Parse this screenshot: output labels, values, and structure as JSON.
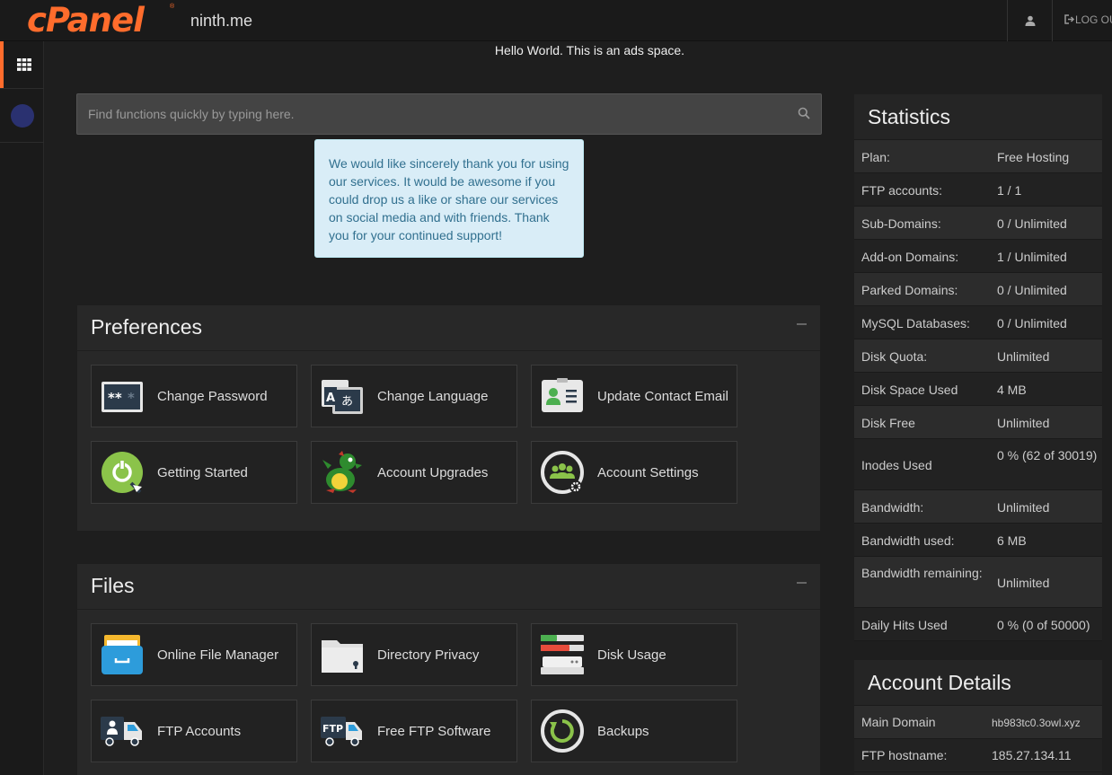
{
  "header": {
    "logo_text": "cPanel",
    "domain": "ninth.me",
    "user_icon": "user-icon",
    "logout_label": "LOG OUT"
  },
  "ads_text": "Hello World. This is an ads space.",
  "search": {
    "placeholder": "Find functions quickly by typing here."
  },
  "notice": "We would like sincerely thank you for using our services. It would be awesome if you could drop us a like or share our services on social media and with friends. Thank you for your continued support!",
  "preferences": {
    "title": "Preferences",
    "items": [
      {
        "label": "Change Password",
        "icon": "password-icon"
      },
      {
        "label": "Change Language",
        "icon": "language-icon"
      },
      {
        "label": "Update Contact Email",
        "icon": "contact-card-icon"
      },
      {
        "label": "Getting Started",
        "icon": "getting-started-icon"
      },
      {
        "label": "Account Upgrades",
        "icon": "dragon-icon"
      },
      {
        "label": "Account Settings",
        "icon": "account-settings-icon"
      }
    ]
  },
  "files": {
    "title": "Files",
    "items": [
      {
        "label": "Online File Manager",
        "icon": "file-manager-icon"
      },
      {
        "label": "Directory Privacy",
        "icon": "folder-lock-icon"
      },
      {
        "label": "Disk Usage",
        "icon": "disk-usage-icon"
      },
      {
        "label": "FTP Accounts",
        "icon": "ftp-accounts-icon"
      },
      {
        "label": "Free FTP Software",
        "icon": "ftp-software-icon"
      },
      {
        "label": "Backups",
        "icon": "backup-icon"
      }
    ]
  },
  "statistics": {
    "title": "Statistics",
    "rows": [
      {
        "label": "Plan:",
        "value": "Free Hosting"
      },
      {
        "label": "FTP accounts:",
        "value": "1 / 1"
      },
      {
        "label": "Sub-Domains:",
        "value": "0 / Unlimited"
      },
      {
        "label": "Add-on Domains:",
        "value": "1 / Unlimited"
      },
      {
        "label": "Parked Domains:",
        "value": "0 / Unlimited"
      },
      {
        "label": "MySQL Databases:",
        "value": "0 / Unlimited"
      },
      {
        "label": "Disk Quota:",
        "value": "Unlimited"
      },
      {
        "label": "Disk Space Used",
        "value": "4 MB"
      },
      {
        "label": "Disk Free",
        "value": "Unlimited"
      },
      {
        "label": "Inodes Used",
        "value": "0 % (62 of 30019)"
      },
      {
        "label": "Bandwidth:",
        "value": "Unlimited"
      },
      {
        "label": "Bandwidth used:",
        "value": "6 MB"
      },
      {
        "label": "Bandwidth remaining:",
        "value": "Unlimited"
      },
      {
        "label": "Daily Hits Used",
        "value": "0 % (0 of 50000)"
      }
    ]
  },
  "account_details": {
    "title": "Account Details",
    "rows": [
      {
        "label": "Main Domain",
        "value": "hb983tc0.3owl.xyz"
      },
      {
        "label": "FTP hostname:",
        "value": "185.27.134.11"
      }
    ]
  },
  "colors": {
    "brand": "#ff6c2c",
    "notice_bg": "#d9edf7",
    "notice_text": "#31708f"
  }
}
